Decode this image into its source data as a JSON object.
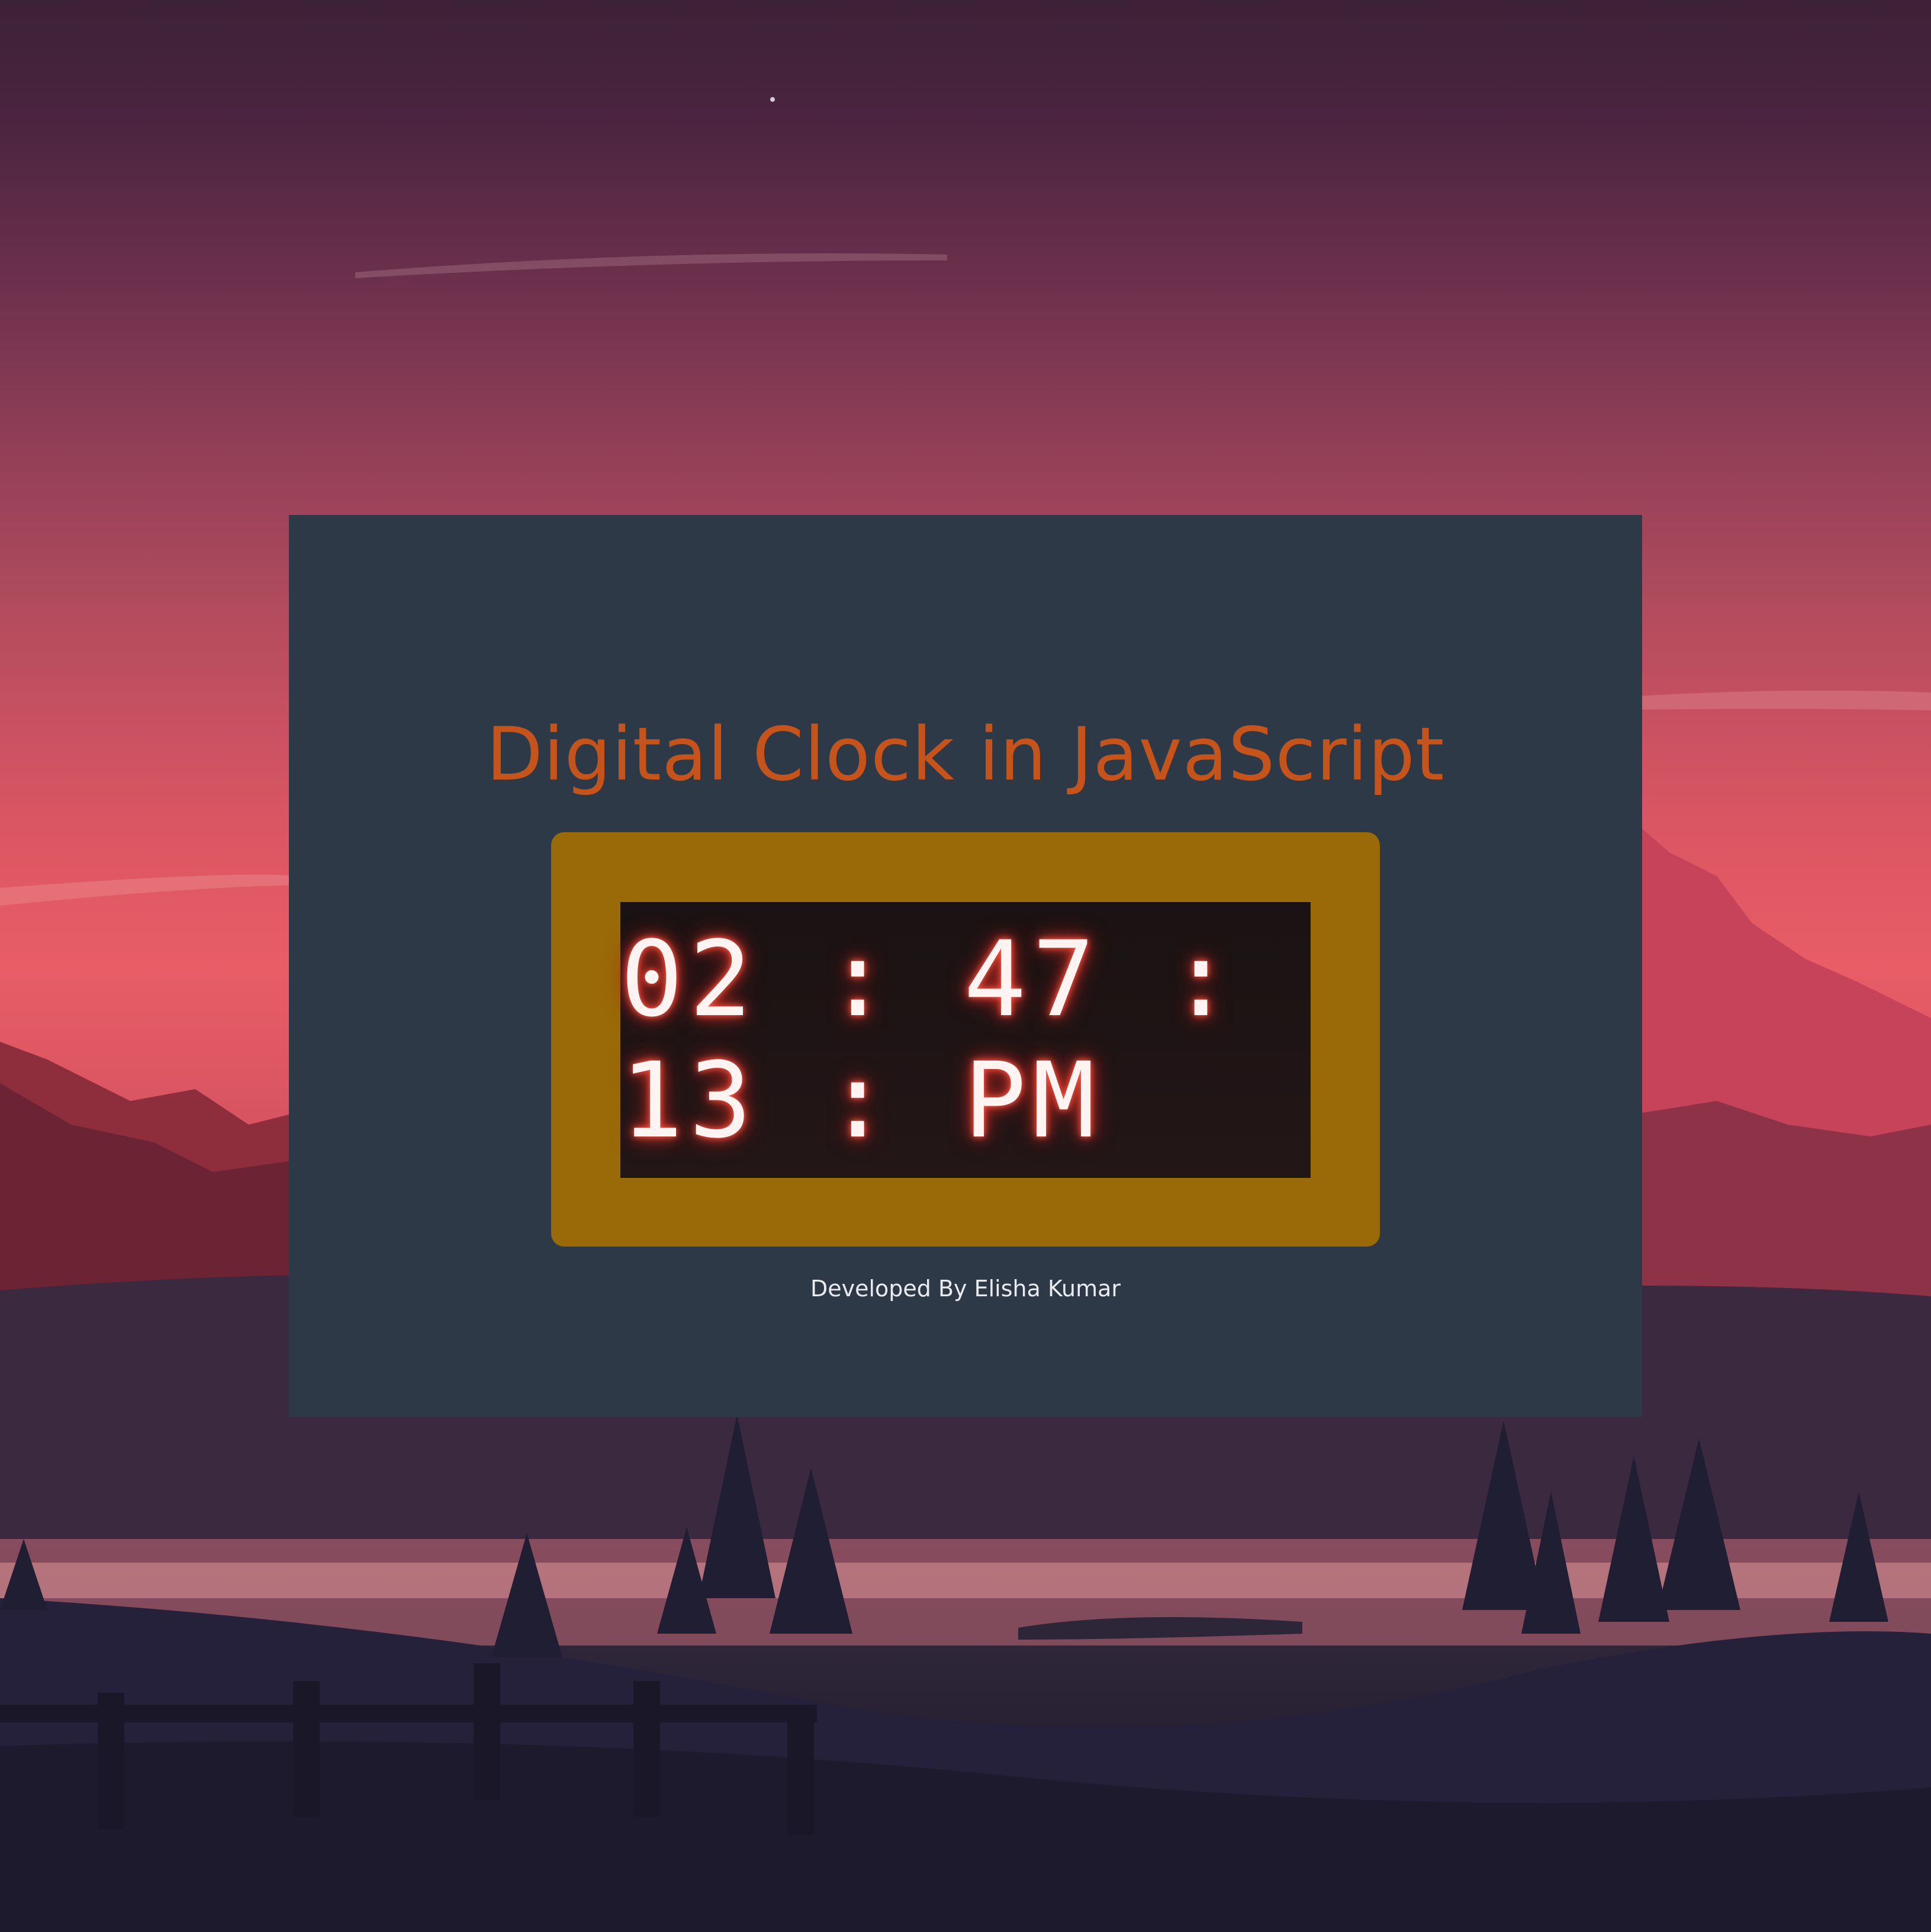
{
  "app": {
    "title": "Digital Clock in JavaScript",
    "credit": "Developed By Elisha Kumar"
  },
  "clock": {
    "display": "02 : 47 : 13 : PM",
    "hours": "02",
    "minutes": "47",
    "seconds": "13",
    "period": "PM"
  },
  "colors": {
    "card_background": "#2d3947",
    "title_text": "#c4541c",
    "frame": "#9a6a08",
    "screen": "#1b1213",
    "digit_glow": "#e2382b",
    "credit_text": "#e9ebee"
  },
  "background": {
    "scene": "sunset-mountains-forest-lake"
  }
}
